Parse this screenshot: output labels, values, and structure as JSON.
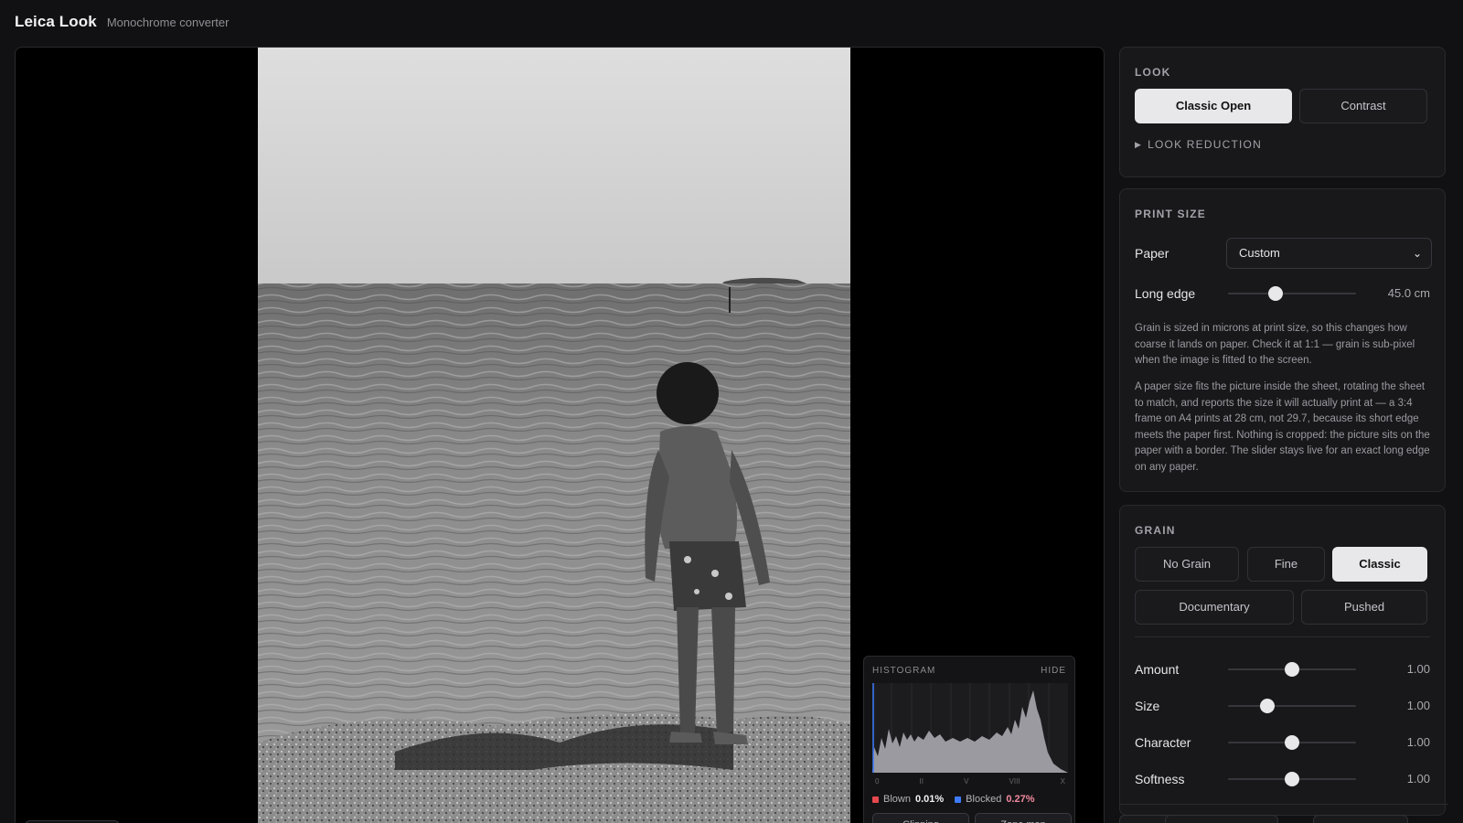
{
  "app": {
    "title": "Leica Look",
    "subtitle": "Monochrome converter"
  },
  "histogram": {
    "title": "HISTOGRAM",
    "hide_label": "HIDE",
    "ticks": [
      "0",
      "II",
      "V",
      "VIII",
      "X"
    ],
    "blown_label": "Blown",
    "blown_value": "0.01%",
    "blocked_label": "Blocked",
    "blocked_value": "0.27%",
    "blown_color": "#e5484d",
    "blocked_color": "#3e7bfa",
    "buttons": [
      "Clipping",
      "Zone map"
    ]
  },
  "look": {
    "title": "LOOK",
    "options": [
      "Classic Open",
      "Contrast"
    ],
    "selected": "Classic Open",
    "reduction_label": "LOOK REDUCTION"
  },
  "print_size": {
    "title": "PRINT SIZE",
    "paper_label": "Paper",
    "paper_value": "Custom",
    "long_edge_label": "Long edge",
    "long_edge_value": "45.0 cm",
    "long_edge_fraction": 0.37,
    "desc1": "Grain is sized in microns at print size, so this changes how coarse it lands on paper. Check it at 1:1 — grain is sub-pixel when the image is fitted to the screen.",
    "desc2": "A paper size fits the picture inside the sheet, rotating the sheet to match, and reports the size it will actually print at — a 3:4 frame on A4 prints at 28 cm, not 29.7, because its short edge meets the paper first. Nothing is cropped: the picture sits on the paper with a border. The slider stays live for an exact long edge on any paper."
  },
  "grain": {
    "title": "GRAIN",
    "options_row1": [
      "No Grain",
      "Fine",
      "Classic"
    ],
    "options_row2": [
      "Documentary",
      "Pushed"
    ],
    "selected": "Classic",
    "amount_label": "Amount",
    "amount_value": "1.00",
    "amount_fraction": 0.5,
    "size_label": "Size",
    "size_value": "1.00",
    "size_fraction": 0.31,
    "character_label": "Character",
    "character_value": "1.00",
    "character_fraction": 0.5,
    "softness_label": "Softness",
    "softness_value": "1.00",
    "softness_fraction": 0.5
  },
  "accent": {
    "active_bg": "#e8e8ea",
    "panel_bg": "#18181b"
  }
}
